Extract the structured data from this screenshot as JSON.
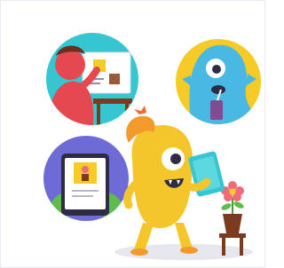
{
  "illustration": {
    "description_icon": "classroom-monster-illustration",
    "palette": {
      "teal": "#35c6d1",
      "yellow": "#f6cb28",
      "purple": "#6f6bd6",
      "blue_monster": "#49b9e3",
      "red_monster": "#e6484f",
      "green_monster": "#5ebc4a",
      "yellow_monster": "#f4c62c",
      "orange_hair": "#f39a2c",
      "plant_pot": "#7a3b1e",
      "flower": "#f06b7a",
      "shadow": "#e6e6ee"
    }
  }
}
